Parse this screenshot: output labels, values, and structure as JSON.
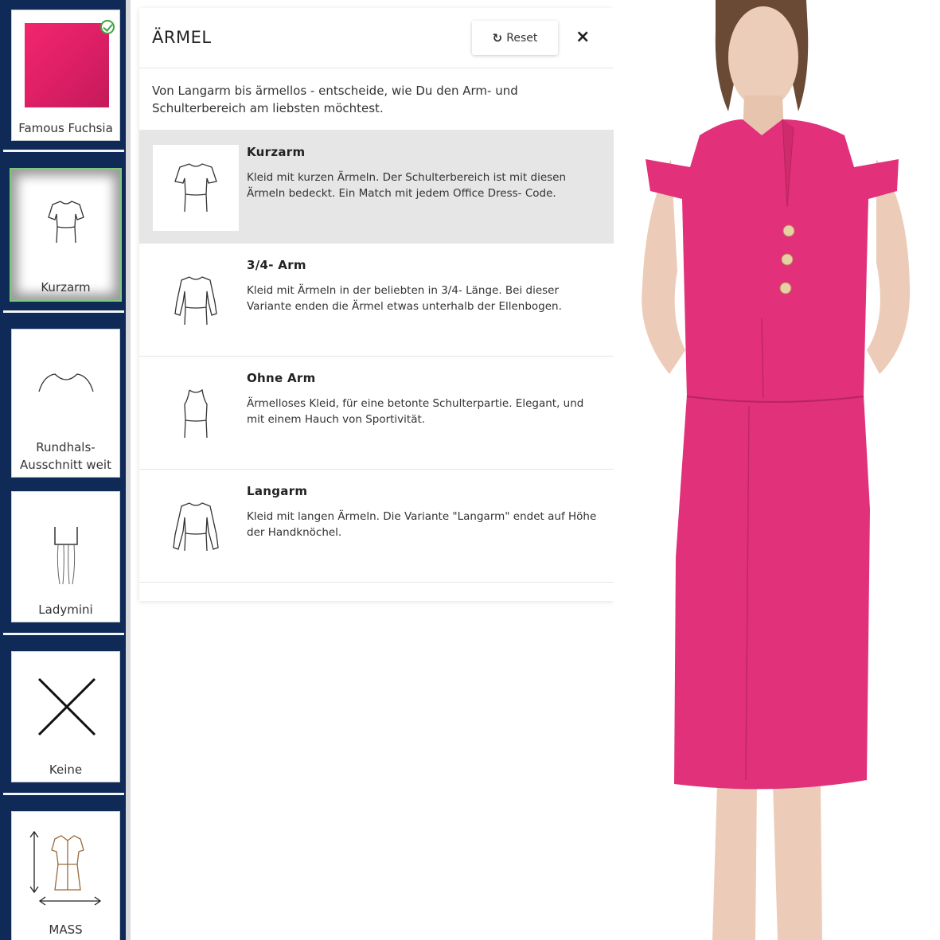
{
  "sidebar": {
    "items": [
      {
        "label": "Famous Fuchsia",
        "color": "#e0206a"
      },
      {
        "label": "Kurzarm"
      },
      {
        "label": "Rundhals-Ausschnitt weit",
        "line1": "Rundhals-",
        "line2": "Ausschnitt weit"
      },
      {
        "label": "Ladymini"
      },
      {
        "label": "Keine"
      },
      {
        "label": "MASS"
      }
    ]
  },
  "panel": {
    "title": "ÄRMEL",
    "reset_label": "Reset",
    "close_label": "×",
    "intro": "Von Langarm bis ärmellos - entscheide, wie Du den Arm- und Schulterbereich am liebsten möchtest.",
    "options": [
      {
        "title": "Kurzarm",
        "desc": "Kleid mit kurzen Ärmeln. Der Schulterbereich ist mit diesen Ärmeln bedeckt. Ein Match mit jedem Office Dress- Code.",
        "selected": true
      },
      {
        "title": "3/4- Arm",
        "desc": "Kleid mit Ärmeln in der beliebten in 3/4- Länge. Bei dieser Variante enden die Ärmel etwas unterhalb der Ellenbogen.",
        "selected": false
      },
      {
        "title": "Ohne Arm",
        "desc": "Ärmelloses Kleid, für eine betonte Schulterpartie. Elegant, und mit einem Hauch von Sportivität.",
        "selected": false
      },
      {
        "title": "Langarm",
        "desc": "Kleid mit langen Ärmeln. Die Variante \"Langarm\" endet auf Höhe der Handknöchel.",
        "selected": false
      }
    ]
  },
  "colors": {
    "sidebar_bg": "#0f2a57",
    "dress": "#e2307a",
    "selected_row": "#e6e6e6",
    "check": "#3aa63a"
  }
}
